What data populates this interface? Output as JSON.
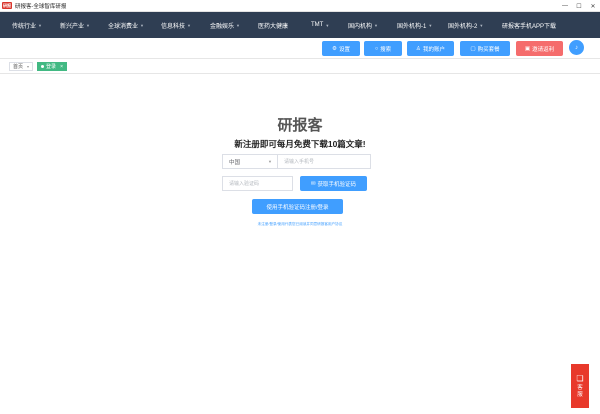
{
  "window": {
    "logo_text": "研报",
    "title": "研报客-全球智库研报",
    "controls": [
      "—",
      "☐",
      "✕"
    ]
  },
  "nav": {
    "items": [
      {
        "label": "传统行业",
        "caret": true
      },
      {
        "label": "新兴产业",
        "caret": true
      },
      {
        "label": "全球消费业",
        "caret": true
      },
      {
        "label": "信息科技",
        "caret": true
      },
      {
        "label": "金融娱乐",
        "caret": true
      },
      {
        "label": "医药大健康",
        "caret": false
      },
      {
        "label": "TMT",
        "caret": true
      },
      {
        "label": "国内机构",
        "caret": true
      },
      {
        "label": "国外机构-1",
        "caret": true
      },
      {
        "label": "国外机构-2",
        "caret": true
      },
      {
        "label": "研报客手机APP下载",
        "caret": false
      }
    ]
  },
  "toolbar": {
    "settings": "设置",
    "search": "搜索",
    "account": "我的账户",
    "buy": "购买套餐",
    "invite": "邀请返利"
  },
  "tabs": {
    "home": "首页",
    "login": "登录"
  },
  "login": {
    "brand": "研报客",
    "slogan": "新注册即可每月免费下载10篇文章!",
    "country": "中国",
    "phone_placeholder": "请输入手机号",
    "code_placeholder": "请输入验证码",
    "get_code": "获取手机验证码",
    "submit": "使用手机验证码注册/登录",
    "agreement": "未注册/登录/使用代表您已阅读并同意研报客用户协议"
  },
  "service": {
    "label": "客服"
  },
  "colors": {
    "nav_bg": "#2f3e53",
    "primary": "#409eff",
    "danger": "#f56c6c",
    "tab_active": "#42b983",
    "service": "#e8392b"
  }
}
